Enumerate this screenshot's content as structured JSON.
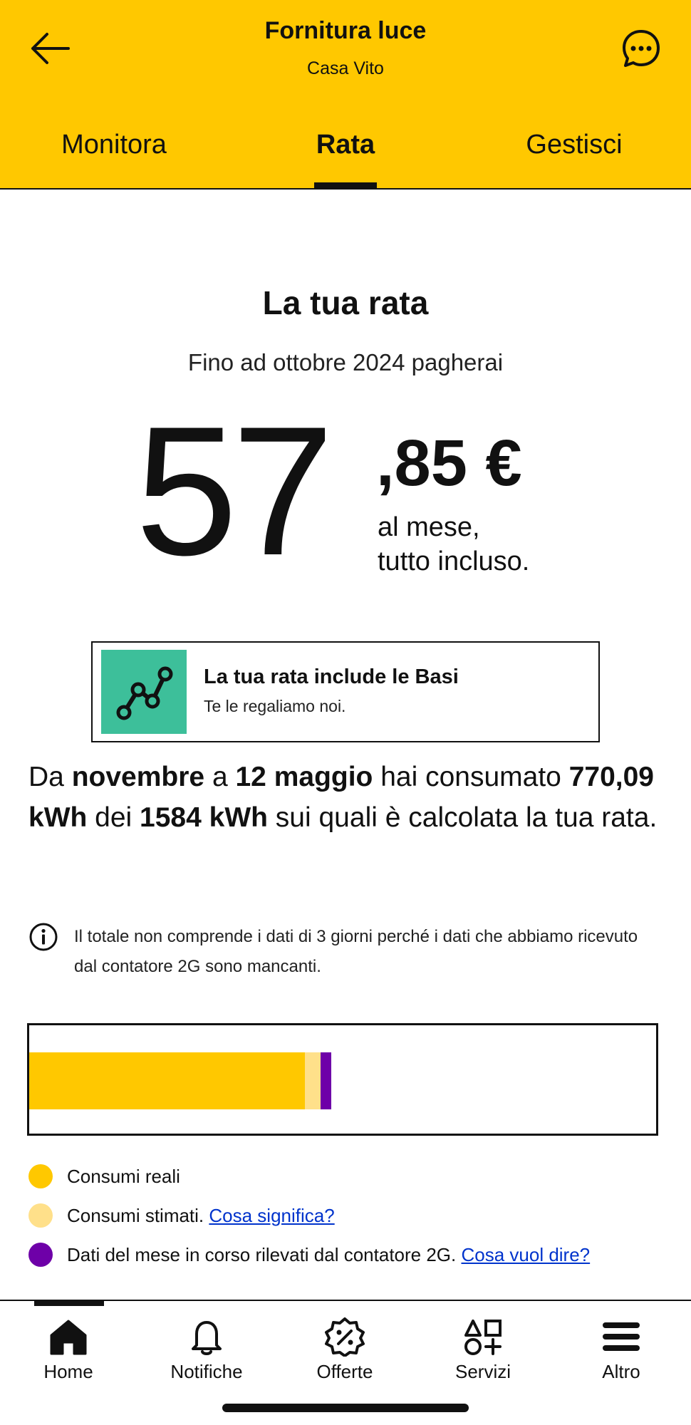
{
  "header": {
    "title": "Fornitura luce",
    "subtitle": "Casa Vito",
    "tabs": [
      {
        "label": "Monitora",
        "active": false
      },
      {
        "label": "Rata",
        "active": true
      },
      {
        "label": "Gestisci",
        "active": false
      }
    ],
    "color": "#FFC800"
  },
  "rata": {
    "title": "La tua rata",
    "subtitle": "Fino ad ottobre 2024 pagherai",
    "amount_int": "57",
    "amount_dec": ",85 €",
    "note_line1": "al mese,",
    "note_line2": "tutto incluso."
  },
  "promo": {
    "title": "La tua rata include le Basi",
    "subtitle": "Te le regaliamo noi.",
    "icon": "graph-line-icon",
    "icon_bg": "#3DBF9A"
  },
  "consumo": {
    "p1": "Da ",
    "b1": "novembre",
    "p2": " a ",
    "b2": "12 maggio",
    "p3": " hai consumato ",
    "b3": "770,09 kWh",
    "p4": " dei ",
    "b4": "1584 kWh",
    "p5": " sui quali è calcolata la tua rata."
  },
  "info": {
    "text": "Il totale non comprende i dati di 3 giorni perché i dati che abbiamo ricevuto dal contatore 2G sono mancanti."
  },
  "bar": {
    "total_kwh": 1584,
    "segments": [
      {
        "name": "Consumi reali",
        "fraction": 0.44,
        "color": "#FFC800"
      },
      {
        "name": "Consumi stimati",
        "fraction": 0.025,
        "color": "#FFE08A"
      },
      {
        "name": "Dati 2G",
        "fraction": 0.017,
        "color": "#6E00A8"
      }
    ]
  },
  "legend": [
    {
      "label": "Consumi reali",
      "link": "",
      "color": "#FFC800"
    },
    {
      "label": "Consumi stimati. ",
      "link": "Cosa significa?",
      "color": "#FFE08A"
    },
    {
      "label": "Dati del mese in corso rilevati dal contatore 2G. ",
      "link": "Cosa vuol dire?",
      "color": "#6E00A8"
    }
  ],
  "nav": [
    {
      "label": "Home",
      "icon": "home-icon",
      "active": true
    },
    {
      "label": "Notifiche",
      "icon": "bell-icon",
      "active": false
    },
    {
      "label": "Offerte",
      "icon": "offer-badge-icon",
      "active": false
    },
    {
      "label": "Servizi",
      "icon": "shapes-icon",
      "active": false
    },
    {
      "label": "Altro",
      "icon": "menu-icon",
      "active": false
    }
  ]
}
